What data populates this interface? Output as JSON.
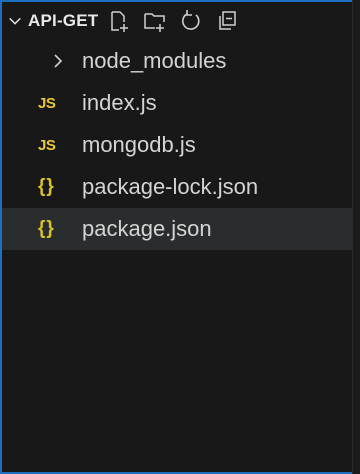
{
  "explorer": {
    "folder_title": "API-GET",
    "actions": [
      {
        "icon": "new-file-icon"
      },
      {
        "icon": "new-folder-icon"
      },
      {
        "icon": "refresh-icon"
      },
      {
        "icon": "collapse-all-icon"
      }
    ],
    "items": [
      {
        "label": "node_modules",
        "kind": "folder",
        "icon": "chevron-right-icon"
      },
      {
        "label": "index.js",
        "kind": "js",
        "badge": "JS"
      },
      {
        "label": "mongodb.js",
        "kind": "js",
        "badge": "JS"
      },
      {
        "label": "package-lock.json",
        "kind": "json",
        "badge": "{}"
      },
      {
        "label": "package.json",
        "kind": "json",
        "badge": "{}",
        "selected": true
      }
    ]
  },
  "colors": {
    "accent_border": "#1f6fc1",
    "js_badge": "#e8c83a",
    "json_badge": "#d9c226",
    "background": "#181818",
    "selected_row": "#2a2d2e"
  }
}
